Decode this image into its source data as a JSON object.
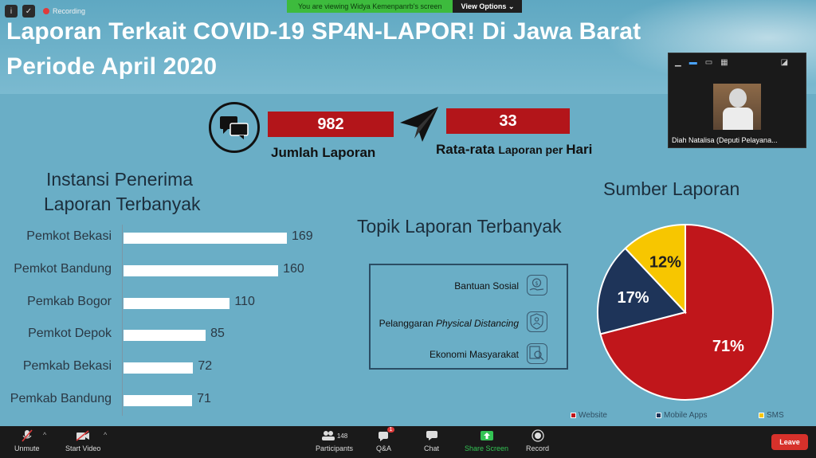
{
  "meeting": {
    "recording_label": "Recording",
    "viewing_text": "You are viewing Widya Kemenpanrb's screen",
    "view_options": "View Options"
  },
  "slide": {
    "title_line1": "Laporan Terkait COVID-19 SP4N-LAPOR! Di Jawa Barat",
    "title_line2": "Periode April 2020",
    "stats": {
      "jumlah_value": "982",
      "jumlah_label": "Jumlah Laporan",
      "rata_value": "33",
      "rata_label_a": "Rata-rata ",
      "rata_label_b": "Laporan per ",
      "rata_label_c": "Hari"
    },
    "bar_title_line1": "Instansi Penerima",
    "bar_title_line2": "Laporan Terbanyak",
    "topics_title": "Topik Laporan Terbanyak",
    "topics": [
      {
        "label": "Bantuan Sosial",
        "icon": "money-hand-icon"
      },
      {
        "label_prefix": "Pelanggaran ",
        "label_italic": "Physical Distancing",
        "icon": "person-shield-icon"
      },
      {
        "label": "Ekonomi Masyarakat",
        "icon": "magnifier-doc-icon"
      }
    ],
    "pie_title": "Sumber Laporan"
  },
  "chart_data": [
    {
      "type": "bar",
      "title": "Instansi Penerima Laporan Terbanyak",
      "orientation": "horizontal",
      "categories": [
        "Pemkot Bekasi",
        "Pemkot Bandung",
        "Pemkab Bogor",
        "Pemkot Depok",
        "Pemkab Bekasi",
        "Pemkab Bandung"
      ],
      "values": [
        169,
        160,
        110,
        85,
        72,
        71
      ],
      "xlim": [
        0,
        180
      ],
      "bar_color": "#ffffff"
    },
    {
      "type": "pie",
      "title": "Sumber Laporan",
      "labels": [
        "Website",
        "Mobile Apps",
        "SMS"
      ],
      "values": [
        71,
        17,
        12
      ],
      "value_labels": [
        "71%",
        "17%",
        "12%"
      ],
      "colors": [
        "#c0161b",
        "#1e3459",
        "#f7c600"
      ],
      "legend": "bottom"
    }
  ],
  "video_tile": {
    "name": "Diah Natalisa (Deputi Pelayana..."
  },
  "toolbar": {
    "unmute": "Unmute",
    "start_video": "Start Video",
    "participants": "Participants",
    "participants_count": "148",
    "qa": "Q&A",
    "qa_badge": "1",
    "chat": "Chat",
    "share_screen": "Share Screen",
    "record": "Record",
    "leave": "Leave"
  },
  "colors": {
    "slide_bg": "#6aaec6",
    "red": "#b3151a",
    "navy": "#1e3459",
    "yellow": "#f7c600",
    "leave_red": "#d7312b",
    "share_green": "#33c454"
  }
}
